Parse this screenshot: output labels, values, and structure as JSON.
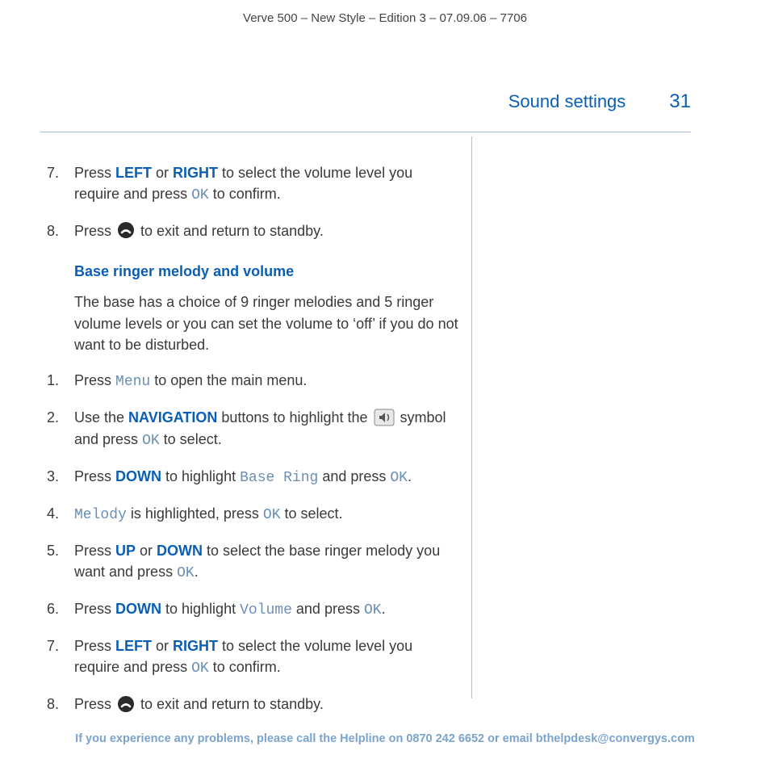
{
  "meta": {
    "top_line": "Verve 500 – New Style – Edition 3 – 07.09.06 – 7706"
  },
  "header": {
    "section": "Sound settings",
    "page": "31"
  },
  "upper_steps_start": 6,
  "upper_steps": {
    "s7_a": "Press ",
    "s7_kw1": "LEFT",
    "s7_b": " or ",
    "s7_kw2": "RIGHT",
    "s7_c": " to select the volume level you require and press ",
    "s7_ok": "OK",
    "s7_d": " to confirm.",
    "s8_a": "Press ",
    "s8_b": " to exit and return to standby."
  },
  "sub": {
    "heading": "Base ringer melody and volume",
    "para": "The base has a choice of 9 ringer melodies and 5 ringer volume levels or you can set the volume to ‘off’ if you do not want to be disturbed."
  },
  "lower_steps": {
    "s1_a": "Press ",
    "s1_menu": "Menu",
    "s1_b": " to open the main menu.",
    "s2_a": "Use the ",
    "s2_nav": "NAVIGATION",
    "s2_b": " buttons to highlight the ",
    "s2_c": " symbol and press ",
    "s2_ok": "OK",
    "s2_d": " to select.",
    "s3_a": "Press ",
    "s3_down": "DOWN",
    "s3_b": " to highlight ",
    "s3_br": "Base Ring",
    "s3_c": " and press ",
    "s3_ok": "OK",
    "s3_d": ".",
    "s4_mel": "Melody",
    "s4_a": " is highlighted, press ",
    "s4_ok": "OK",
    "s4_b": " to select.",
    "s5_a": "Press ",
    "s5_up": "UP",
    "s5_b": " or ",
    "s5_down": "DOWN",
    "s5_c": " to select the base ringer melody you want and press ",
    "s5_ok": "OK",
    "s5_d": ".",
    "s6_a": "Press ",
    "s6_down": "DOWN",
    "s6_b": " to highlight ",
    "s6_vol": "Volume",
    "s6_c": " and press ",
    "s6_ok": "OK",
    "s6_d": ".",
    "s7_a": "Press ",
    "s7_left": "LEFT",
    "s7_b": " or ",
    "s7_right": "RIGHT",
    "s7_c": " to select the volume level you require and press ",
    "s7_ok": "OK",
    "s7_d": " to confirm.",
    "s8_a": "Press ",
    "s8_b": " to exit and return to standby."
  },
  "footer": {
    "text": "If you experience any problems, please call the Helpline on 0870 242 6652 or email bthelpdesk@convergys.com"
  }
}
